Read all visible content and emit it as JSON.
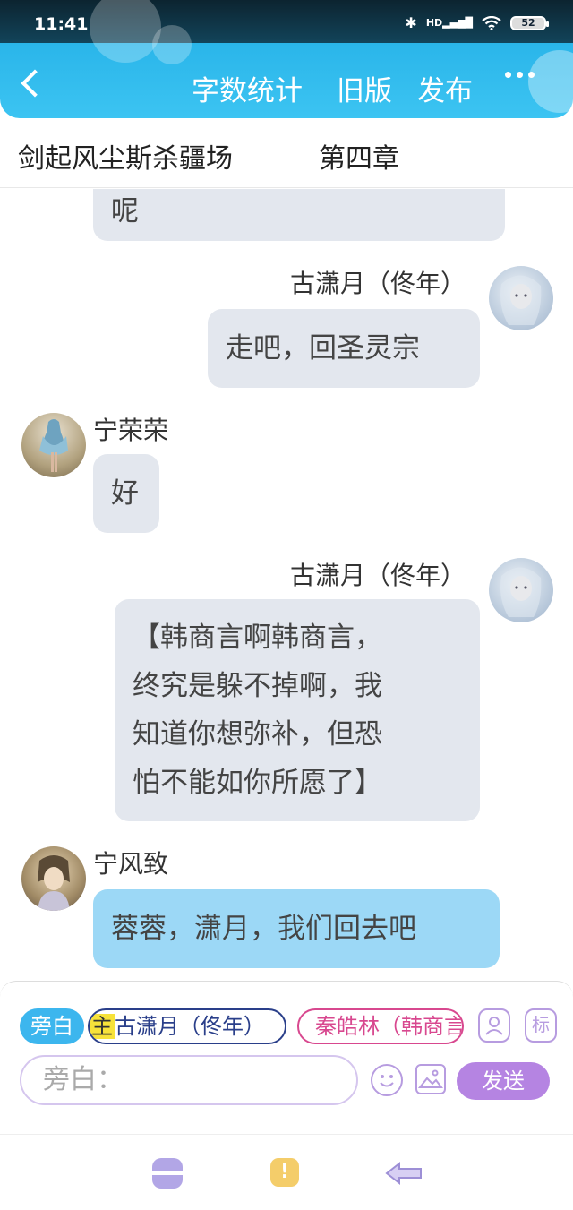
{
  "status_bar": {
    "time": "11:41",
    "battery": "52",
    "signal_label": "HD"
  },
  "nav": {
    "word_count": "字数统计",
    "old_version": "旧版",
    "publish": "发布"
  },
  "story": {
    "book_title": "剑起风尘斯杀疆场",
    "chapter": "第四章"
  },
  "messages": [
    {
      "side": "left",
      "text": "呢"
    },
    {
      "side": "right",
      "name": "古潇月（佟年）",
      "text": "走吧，回圣灵宗"
    },
    {
      "side": "left",
      "name": "宁荣荣",
      "text": "好"
    },
    {
      "side": "right",
      "name": "古潇月（佟年）",
      "lines": [
        "【韩商言啊韩商言，",
        "终究是躲不掉啊，我",
        "知道你想弥补，但恐",
        "怕不能如你所愿了】"
      ]
    },
    {
      "side": "left",
      "name": "宁风致",
      "text": "蓉蓉，潇月，我们回去吧"
    }
  ],
  "roles": {
    "narrator": "旁白",
    "main_tag": "主",
    "main_role": "古潇月（佟年）",
    "other_role": "秦皓林（韩商言"
  },
  "role_icons": {
    "character": "character-card-icon",
    "mark": "标"
  },
  "input": {
    "placeholder": "旁白："
  },
  "send_label": "发送",
  "colors": {
    "header_blue": "#2bb6ea",
    "bubble_gray": "#e3e7ee",
    "bubble_blue": "#9cd8f6",
    "send_purple": "#b584e2",
    "main_chip_border": "#2a3f8a",
    "other_chip_border": "#d8488f",
    "highlight_yellow": "#f7e23a"
  }
}
